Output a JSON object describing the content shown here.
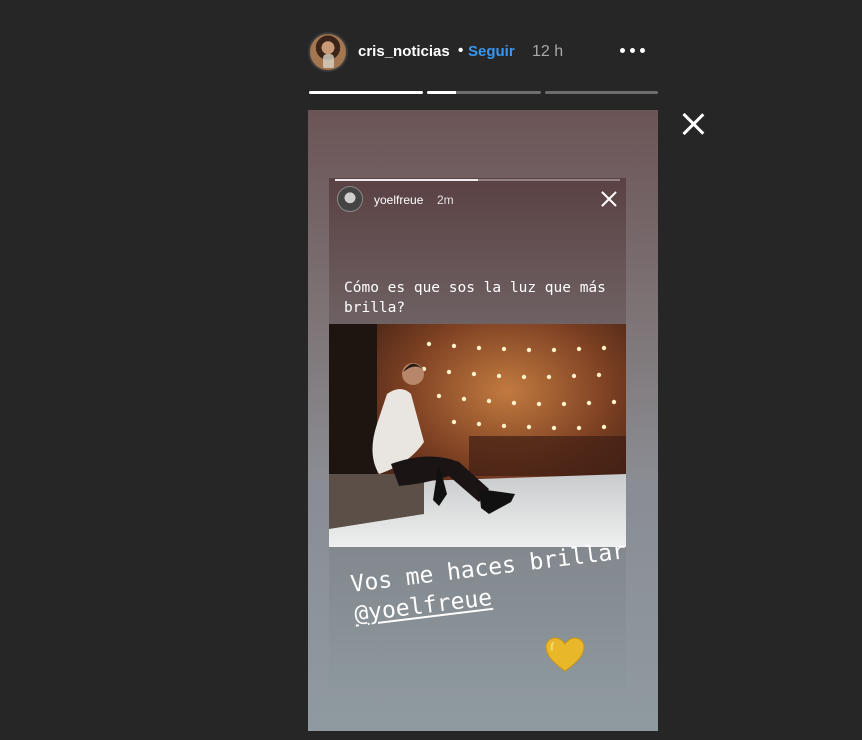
{
  "header": {
    "username": "cris_noticias",
    "separator": "•",
    "follow_label": "Seguir",
    "time": "12 h",
    "more_icon": "more-horizontal-icon",
    "follow_color": "#3897f0"
  },
  "progress": [
    {
      "fill": 1.0
    },
    {
      "fill": 0.25
    },
    {
      "fill": 0.0
    }
  ],
  "close_icon": "close-icon",
  "story": {
    "inner": {
      "username": "yoelfreue",
      "time": "2m",
      "progress_fill": 0.5,
      "question": "Cómo es que sos la luz que más brilla?"
    },
    "caption_text": "Vos me haces brillar ",
    "caption_mention": "@yoelfreue",
    "sticker": "yellow-heart-icon"
  }
}
